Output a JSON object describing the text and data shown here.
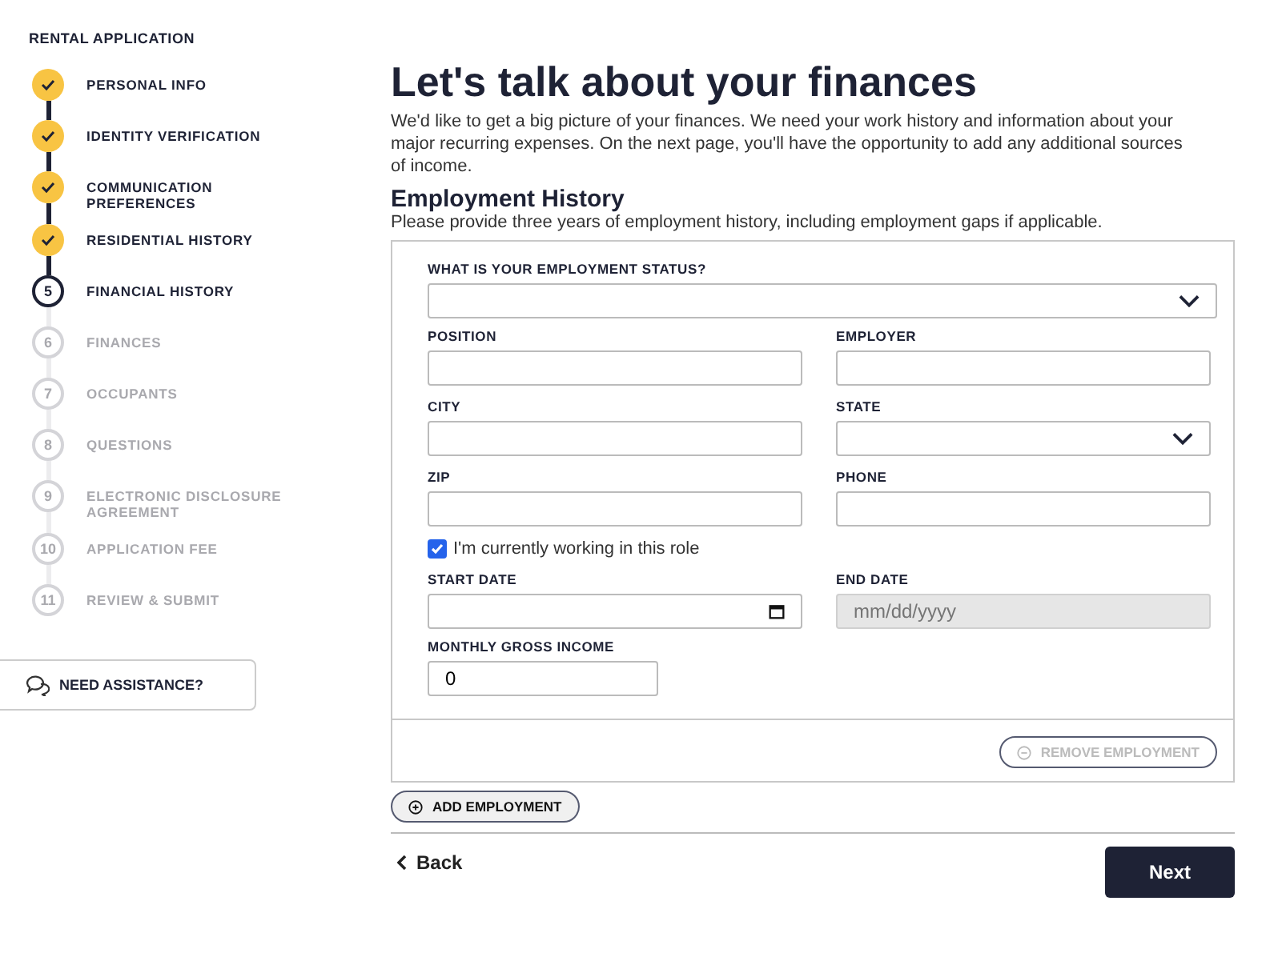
{
  "sidebar": {
    "title": "RENTAL APPLICATION",
    "steps": [
      {
        "kind": "done",
        "label": "PERSONAL INFO"
      },
      {
        "kind": "done",
        "label": "IDENTITY VERIFICATION"
      },
      {
        "kind": "done",
        "label": "COMMUNICATION PREFERENCES"
      },
      {
        "kind": "done",
        "label": "RESIDENTIAL HISTORY"
      },
      {
        "kind": "current",
        "number": "5",
        "label": "FINANCIAL HISTORY"
      },
      {
        "kind": "upcoming",
        "number": "6",
        "label": "FINANCES"
      },
      {
        "kind": "upcoming",
        "number": "7",
        "label": "OCCUPANTS"
      },
      {
        "kind": "upcoming",
        "number": "8",
        "label": "QUESTIONS"
      },
      {
        "kind": "upcoming",
        "number": "9",
        "label": "ELECTRONIC DISCLOSURE AGREEMENT"
      },
      {
        "kind": "upcoming",
        "number": "10",
        "label": "APPLICATION FEE"
      },
      {
        "kind": "upcoming",
        "number": "11",
        "label": "REVIEW & SUBMIT"
      }
    ],
    "help_button": "NEED ASSISTANCE?"
  },
  "main": {
    "title": "Let's talk about your finances",
    "intro": "We'd like to get a big picture of your finances. We need your work history and information about your major recurring expenses. On the next page, you'll have the opportunity to add any additional sources of income.",
    "section_title": "Employment History",
    "section_note": "Please provide three years of employment history, including employment gaps if applicable.",
    "form": {
      "status": {
        "kind": "select",
        "label": "WHAT IS YOUR EMPLOYMENT STATUS?"
      },
      "fields": [
        {
          "kind": "text",
          "label": "POSITION"
        },
        {
          "kind": "text",
          "label": "EMPLOYER"
        },
        {
          "kind": "text",
          "label": "CITY"
        },
        {
          "kind": "select",
          "label": "STATE"
        },
        {
          "kind": "text",
          "label": "ZIP"
        },
        {
          "kind": "text",
          "label": "PHONE"
        }
      ],
      "current_role": {
        "label": "I'm currently working in this role",
        "checked": true
      },
      "dates": [
        {
          "kind": "date",
          "label": "START DATE",
          "disabled": false
        },
        {
          "kind": "text",
          "label": "END DATE",
          "placeholder": "mm/dd/yyyy",
          "disabled": true
        }
      ],
      "income": {
        "label": "MONTHLY GROSS INCOME",
        "value": "0"
      },
      "remove_button": {
        "label": "REMOVE EMPLOYMENT",
        "disabled": true
      }
    },
    "add_button": "ADD EMPLOYMENT",
    "back_link": "Back",
    "next_button": "Next"
  }
}
